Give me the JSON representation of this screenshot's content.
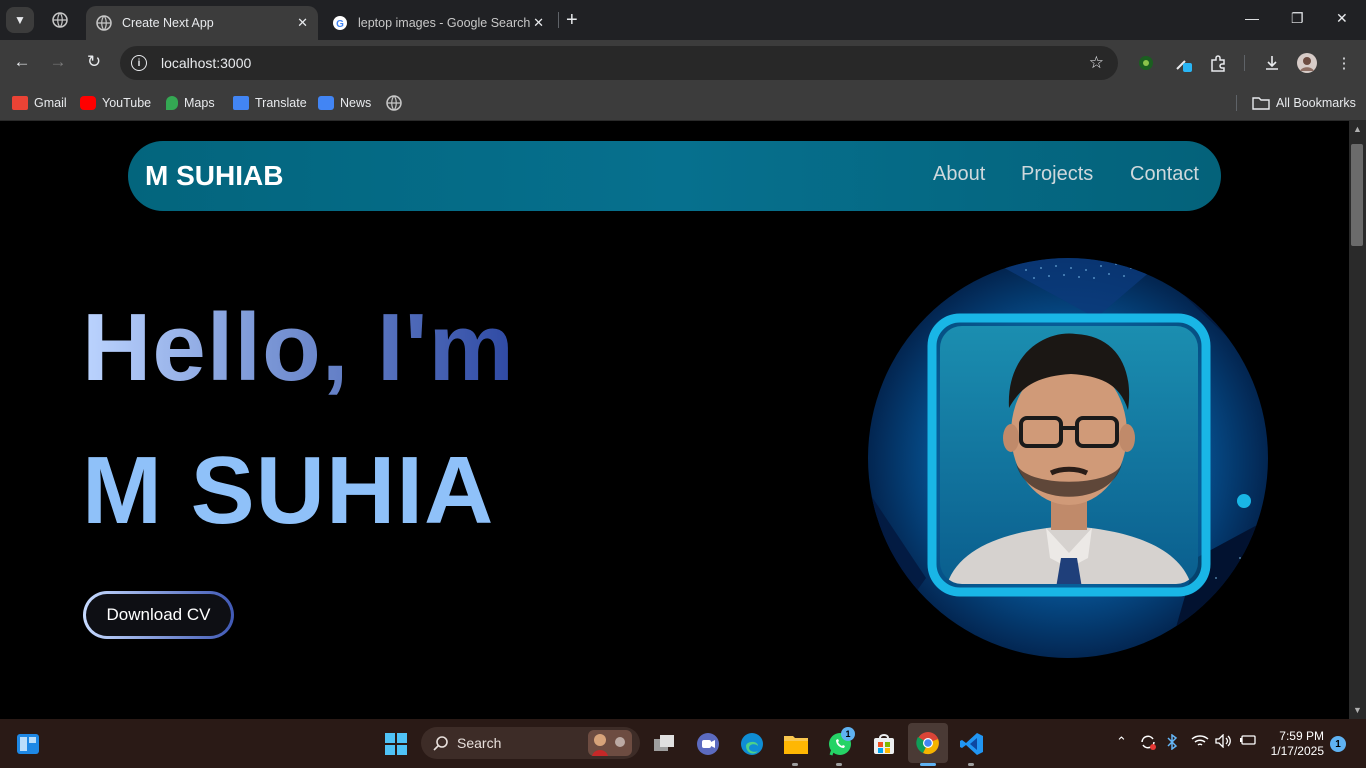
{
  "browser": {
    "tabs": [
      {
        "title": "Create Next App",
        "active": true
      },
      {
        "title": "leptop images - Google Search",
        "active": false
      }
    ],
    "url": "localhost:3000",
    "bookmarks": [
      {
        "label": "Gmail",
        "color": "#ea4335"
      },
      {
        "label": "YouTube",
        "color": "#ff0000"
      },
      {
        "label": "Maps",
        "color": "#34a853"
      },
      {
        "label": "Translate",
        "color": "#4285f4"
      },
      {
        "label": "News",
        "color": "#4285f4"
      }
    ],
    "all_bookmarks_label": "All Bookmarks"
  },
  "site": {
    "brand": "M SUHIAB",
    "nav": [
      "About",
      "Projects",
      "Contact"
    ],
    "hero_greeting": "Hello, I'm",
    "hero_name": "M SUHIA",
    "cta_label": "Download CV"
  },
  "taskbar": {
    "search_placeholder": "Search",
    "whatsapp_badge": "1",
    "time": "7:59 PM",
    "date": "1/17/2025",
    "notification_count": "1"
  },
  "colors": {
    "navbar": "#06708e",
    "accent_name": "#8fc1f9",
    "frame": "#19b6e6"
  }
}
